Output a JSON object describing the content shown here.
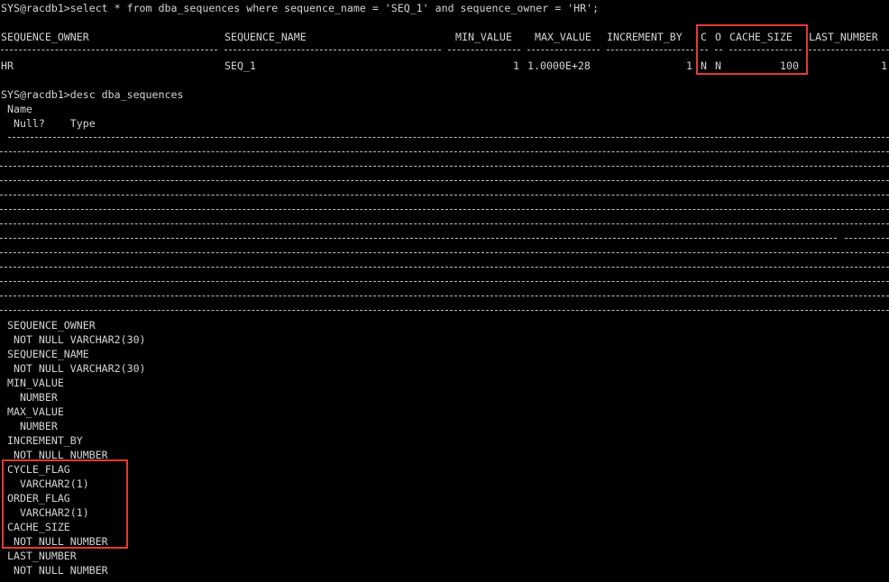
{
  "query": {
    "prompt_line": "SYS@racdb1>select * from dba_sequences where sequence_name = 'SEQ_1' and sequence_owner = 'HR';",
    "headers": {
      "sequence_owner": "SEQUENCE_OWNER",
      "sequence_name": "SEQUENCE_NAME",
      "min_value": "MIN_VALUE",
      "max_value": "MAX_VALUE",
      "increment_by": "INCREMENT_BY",
      "c": "C",
      "o": "O",
      "cache_size": "CACHE_SIZE",
      "last_number": "LAST_NUMBER"
    },
    "row": {
      "sequence_owner": "HR",
      "sequence_name": "SEQ_1",
      "min_value": "1",
      "max_value": "1.0000E+28",
      "increment_by": "1",
      "c": "N",
      "o": "N",
      "cache_size": "100",
      "last_number": "1"
    }
  },
  "desc": {
    "prompt_line": "SYS@racdb1>desc dba_sequences",
    "name_header": " Name",
    "null_type_header": "  Null?    Type",
    "columns": [
      {
        "name": " SEQUENCE_OWNER",
        "type": "  NOT NULL VARCHAR2(30)"
      },
      {
        "name": " SEQUENCE_NAME",
        "type": "  NOT NULL VARCHAR2(30)"
      },
      {
        "name": " MIN_VALUE",
        "type": "   NUMBER"
      },
      {
        "name": " MAX_VALUE",
        "type": "   NUMBER"
      },
      {
        "name": " INCREMENT_BY",
        "type": "  NOT NULL NUMBER"
      },
      {
        "name": " CYCLE_FLAG",
        "type": "   VARCHAR2(1)"
      },
      {
        "name": " ORDER_FLAG",
        "type": "   VARCHAR2(1)"
      },
      {
        "name": " CACHE_SIZE",
        "type": "  NOT NULL NUMBER"
      },
      {
        "name": " LAST_NUMBER",
        "type": "  NOT NULL NUMBER"
      }
    ]
  },
  "colors": {
    "background": "#000000",
    "text": "#d4d4d4",
    "highlight": "#e53935"
  }
}
